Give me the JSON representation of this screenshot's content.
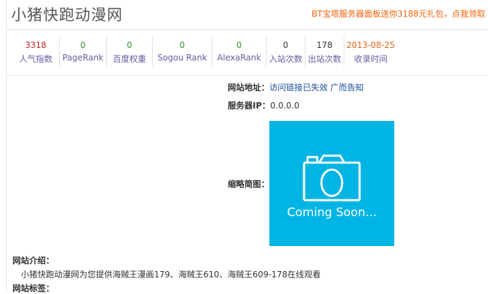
{
  "header": {
    "title": "小猪快跑动漫网",
    "promo": "BT宝塔服务器面板送你3188元礼包，点我领取"
  },
  "stats": [
    {
      "value": "3318",
      "label": "人气指数",
      "color": "#cc2222"
    },
    {
      "value": "0",
      "label": "PageRank",
      "color": "#2f8f2f"
    },
    {
      "value": "0",
      "label": "百度权重",
      "color": "#2f8f2f"
    },
    {
      "value": "0",
      "label": "Sogou Rank",
      "color": "#2f8f2f"
    },
    {
      "value": "0",
      "label": "AlexaRank",
      "color": "#2f8f2f"
    },
    {
      "value": "0",
      "label": "入站次数",
      "color": "#333333"
    },
    {
      "value": "178",
      "label": "出站次数",
      "color": "#333333"
    },
    {
      "value": "2013-08-25",
      "label": "收录时间",
      "color": "#e0651a"
    }
  ],
  "info": {
    "url_label": "网站地址：",
    "url_status": "访问链接已失效",
    "ad_link": "广而告知",
    "ip_label": "服务器IP：",
    "ip_value": "0.0.0.0",
    "thumb_label": "缩略简图：",
    "thumb_text": "Coming Soon..."
  },
  "intro": {
    "label": "网站介绍：",
    "text": "小猪快跑动漫网为您提供海贼王漫画179、海贼王610、海贼王609-178在线观看"
  },
  "tags": {
    "label": "网站标签："
  }
}
